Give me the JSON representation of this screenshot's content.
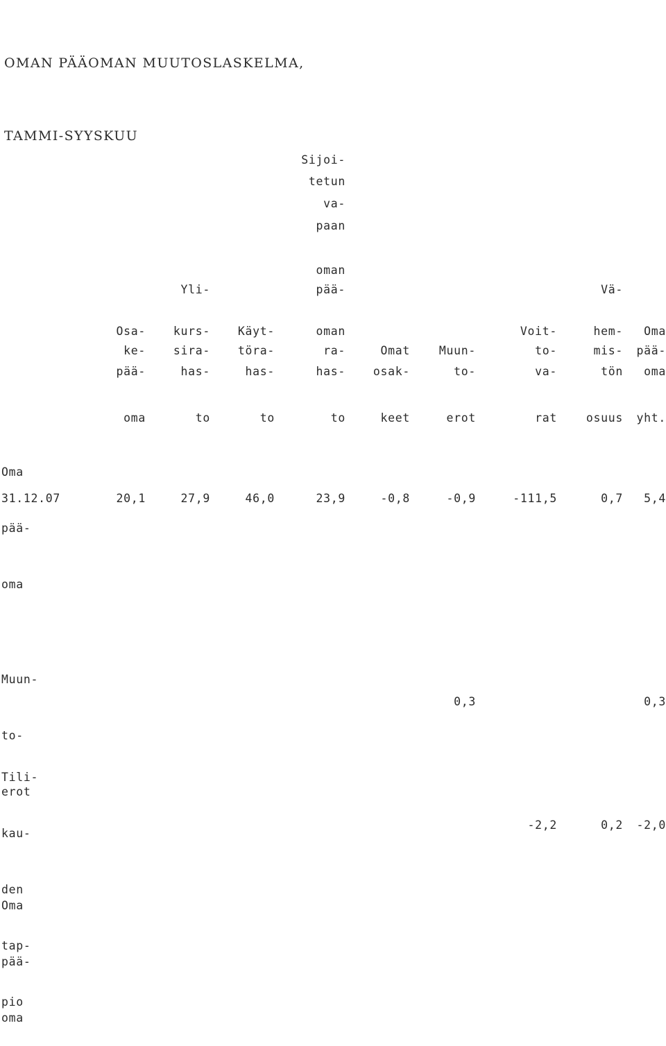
{
  "document": {
    "title_lines": [
      "OMAN PÄÄOMAN MUUTOSLASKELMA,",
      "TAMMI-SYYSKUU"
    ]
  },
  "table": {
    "stacked_headers": {
      "sijoitetun_stack": [
        "Sijoi-",
        "tetun",
        "va-",
        "paan"
      ],
      "oman_paa_stack": [
        "oman",
        "pää-"
      ],
      "yli_label": "Yli-",
      "va_label": "Vä-"
    },
    "column_headers": [
      {
        "lines": [
          "Osa-",
          "ke-",
          "pää-",
          "oma"
        ]
      },
      {
        "lines": [
          "kurs-",
          "sira-",
          "has-",
          "to"
        ]
      },
      {
        "lines": [
          "Käyt-",
          "töra-",
          "has-",
          "to"
        ]
      },
      {
        "lines": [
          "oman",
          "ra-",
          "has-",
          "to"
        ]
      },
      {
        "lines": [
          "",
          "Omat",
          "osak-",
          "keet"
        ]
      },
      {
        "lines": [
          "",
          "Muun-",
          "to-",
          "erot"
        ]
      },
      {
        "lines": [
          "Voit-",
          "to-",
          "va-",
          "rat"
        ]
      },
      {
        "lines": [
          "hem-",
          "mis-",
          "tön",
          "osuus"
        ]
      },
      {
        "lines": [
          "Oma",
          "pää-",
          "oma",
          "yht."
        ]
      }
    ],
    "rows": [
      {
        "label_lines": [
          "Oma",
          "pää-",
          "oma"
        ],
        "date": "31.12.07",
        "values": [
          "20,1",
          "27,9",
          "46,0",
          "23,9",
          "-0,8",
          "-0,9",
          "-111,5",
          "0,7",
          "5,4"
        ]
      },
      {
        "label_lines": [
          "Muun-",
          "to-",
          "erot"
        ],
        "date": "",
        "values": [
          "",
          "",
          "",
          "",
          "",
          "0,3",
          "",
          "",
          "0,3"
        ]
      },
      {
        "label_lines": [
          "Tili-",
          "kau-",
          "den",
          "tap-",
          "pio"
        ],
        "date": "",
        "values": [
          "",
          "",
          "",
          "",
          "",
          "",
          "-2,2",
          "0,2",
          "-2,0"
        ]
      },
      {
        "label_lines": [
          "Oma",
          "pää-",
          "oma"
        ],
        "date": "",
        "values": [
          "",
          "",
          "",
          "",
          "",
          "",
          "",
          "",
          ""
        ]
      }
    ]
  }
}
